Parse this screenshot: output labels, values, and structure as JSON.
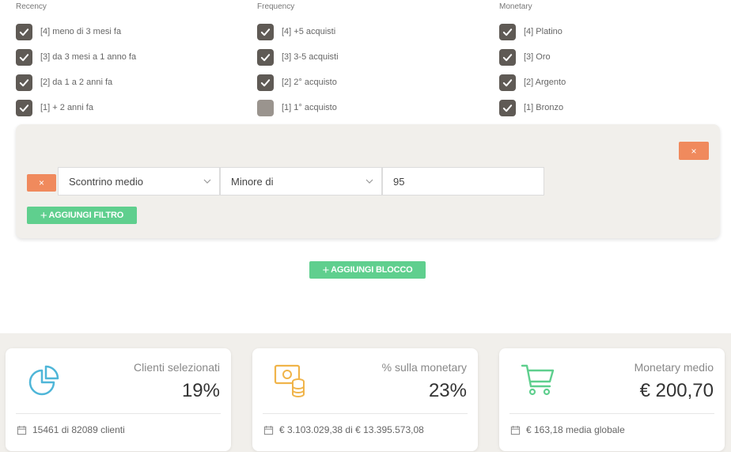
{
  "rfm": {
    "recency": {
      "title": "Recency",
      "items": [
        {
          "label": "[4] meno di 3 mesi fa",
          "checked": true
        },
        {
          "label": "[3] da 3 mesi a 1 anno fa",
          "checked": true
        },
        {
          "label": "[2] da 1 a 2 anni fa",
          "checked": true
        },
        {
          "label": "[1] + 2 anni fa",
          "checked": true
        }
      ]
    },
    "frequency": {
      "title": "Frequency",
      "items": [
        {
          "label": "[4] +5 acquisti",
          "checked": true
        },
        {
          "label": "[3] 3-5 acquisti",
          "checked": true
        },
        {
          "label": "[2] 2° acquisto",
          "checked": true
        },
        {
          "label": "[1] 1° acquisto",
          "checked": false
        }
      ]
    },
    "monetary": {
      "title": "Monetary",
      "items": [
        {
          "label": "[4] Platino",
          "checked": true
        },
        {
          "label": "[3] Oro",
          "checked": true
        },
        {
          "label": "[2] Argento",
          "checked": true
        },
        {
          "label": "[1] Bronzo",
          "checked": true
        }
      ]
    }
  },
  "block": {
    "remove_block_label": "×",
    "filter": {
      "remove_label": "×",
      "field_value": "Scontrino medio",
      "operator_value": "Minore di",
      "amount_value": "95"
    },
    "add_filter_label": "AGGIUNGI FILTRO"
  },
  "add_block_label": "AGGIUNGI BLOCCO",
  "cards": [
    {
      "title": "Clienti selezionati",
      "value": "19%",
      "footer": "15461 di 82089 clienti",
      "icon": "pie-chart-icon",
      "color": "#4fb6d8"
    },
    {
      "title": "% sulla monetary",
      "value": "23%",
      "footer": "€ 3.103.029,38 di € 13.395.573,08",
      "icon": "money-coins-icon",
      "color": "#f0b44a"
    },
    {
      "title": "Monetary medio",
      "value": "€ 200,70",
      "footer": "€ 163,18 media globale",
      "icon": "cart-icon",
      "color": "#5fcf8e"
    }
  ]
}
